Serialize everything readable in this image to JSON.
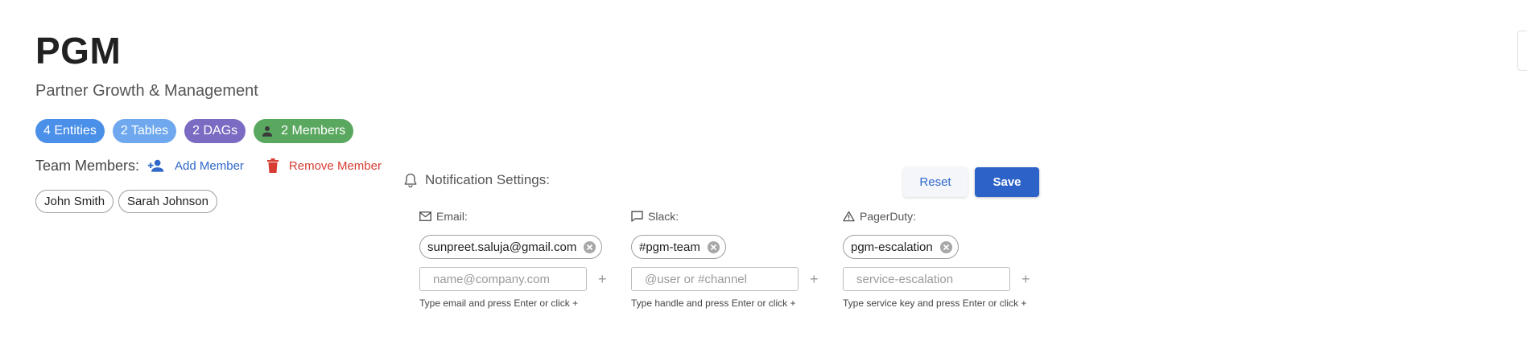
{
  "team": {
    "title": "PGM",
    "subtitle": "Partner Growth & Management"
  },
  "stats": {
    "entities": "4 Entities",
    "tables": "2 Tables",
    "dags": "2 DAGs",
    "members": "2 Members"
  },
  "members_section": {
    "label": "Team Members:",
    "add_label": "Add Member",
    "remove_label": "Remove Member",
    "members": [
      "John Smith",
      "Sarah Johnson"
    ]
  },
  "notifications": {
    "label": "Notification Settings:",
    "reset_label": "Reset",
    "save_label": "Save",
    "email": {
      "label": "Email:",
      "value": "sunpreet.saluja@gmail.com",
      "placeholder": "name@company.com",
      "add_symbol": "+",
      "hint": "Type email and press Enter or click +"
    },
    "slack": {
      "label": "Slack:",
      "value": "#pgm-team",
      "placeholder": "@user or #channel",
      "add_symbol": "+",
      "hint": "Type handle and press Enter or click +"
    },
    "pagerduty": {
      "label": "PagerDuty:",
      "value": "pgm-escalation",
      "placeholder": "service-escalation",
      "add_symbol": "+",
      "hint": "Type service key and press Enter or click +"
    }
  },
  "colors": {
    "entities_chip": "#4a8fe8",
    "tables_chip": "#6fa8ee",
    "dags_chip": "#7b6bc2",
    "members_chip": "#5aa85f",
    "primary": "#2d63c8",
    "danger": "#d63c31"
  },
  "icons": {
    "members_chip": "person-icon",
    "add_member": "person-add-icon",
    "remove_member": "trash-icon",
    "notifications": "bell-icon",
    "email": "mail-icon",
    "slack": "chat-bubble-icon",
    "pagerduty": "warning-icon",
    "chip_remove": "close-circle-icon"
  }
}
